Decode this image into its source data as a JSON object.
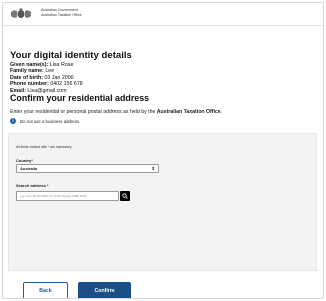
{
  "header": {
    "gov_line1": "Australian Government",
    "gov_line2": "Australian Taxation Office"
  },
  "identity": {
    "title": "Your digital identity details",
    "given_label": "Given name(s):",
    "given_value": "Lisa Rose",
    "family_label": "Family name:",
    "family_value": "Lee",
    "dob_label": "Date of birth:",
    "dob_value": "03 Jan 2000",
    "phone_label": "Phone number:",
    "phone_value": "0402 156 678",
    "email_label": "Email:",
    "email_value": "Lisa@gmail.com"
  },
  "address": {
    "title": "Confirm your residential address",
    "intro_text": "Enter your residential or personal postal address as held by the",
    "intro_org": "Australian Taxation Office",
    "intro_end": ".",
    "info_icon": "info-icon",
    "info_text": "Do not use a business address.",
    "mandatory_note": "All fields marked with * are mandatory.",
    "country_label": "Country*",
    "country_value": "Australia",
    "search_label": "Search address *",
    "search_placeholder": "e.g. level 10 120 Miller St. North Sydney NSW 2060"
  },
  "buttons": {
    "back": "Back",
    "confirm": "Confirm"
  },
  "colors": {
    "primary": "#1b4f86",
    "link_blue": "#1f5fa6",
    "panel_bg": "#f3f3f3"
  }
}
